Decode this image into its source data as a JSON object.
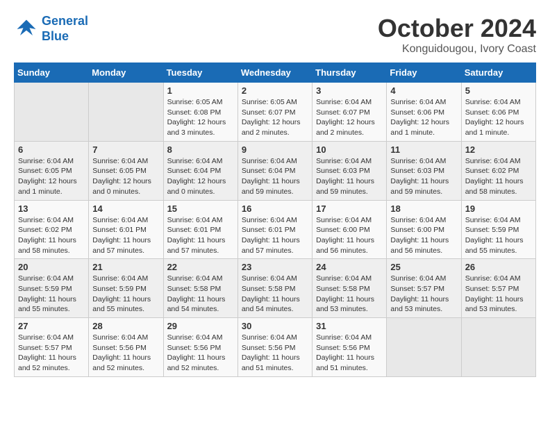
{
  "logo": {
    "line1": "General",
    "line2": "Blue"
  },
  "title": "October 2024",
  "location": "Konguidougou, Ivory Coast",
  "weekdays": [
    "Sunday",
    "Monday",
    "Tuesday",
    "Wednesday",
    "Thursday",
    "Friday",
    "Saturday"
  ],
  "weeks": [
    [
      {
        "day": "",
        "info": ""
      },
      {
        "day": "",
        "info": ""
      },
      {
        "day": "1",
        "info": "Sunrise: 6:05 AM\nSunset: 6:08 PM\nDaylight: 12 hours\nand 3 minutes."
      },
      {
        "day": "2",
        "info": "Sunrise: 6:05 AM\nSunset: 6:07 PM\nDaylight: 12 hours\nand 2 minutes."
      },
      {
        "day": "3",
        "info": "Sunrise: 6:04 AM\nSunset: 6:07 PM\nDaylight: 12 hours\nand 2 minutes."
      },
      {
        "day": "4",
        "info": "Sunrise: 6:04 AM\nSunset: 6:06 PM\nDaylight: 12 hours\nand 1 minute."
      },
      {
        "day": "5",
        "info": "Sunrise: 6:04 AM\nSunset: 6:06 PM\nDaylight: 12 hours\nand 1 minute."
      }
    ],
    [
      {
        "day": "6",
        "info": "Sunrise: 6:04 AM\nSunset: 6:05 PM\nDaylight: 12 hours\nand 1 minute."
      },
      {
        "day": "7",
        "info": "Sunrise: 6:04 AM\nSunset: 6:05 PM\nDaylight: 12 hours\nand 0 minutes."
      },
      {
        "day": "8",
        "info": "Sunrise: 6:04 AM\nSunset: 6:04 PM\nDaylight: 12 hours\nand 0 minutes."
      },
      {
        "day": "9",
        "info": "Sunrise: 6:04 AM\nSunset: 6:04 PM\nDaylight: 11 hours\nand 59 minutes."
      },
      {
        "day": "10",
        "info": "Sunrise: 6:04 AM\nSunset: 6:03 PM\nDaylight: 11 hours\nand 59 minutes."
      },
      {
        "day": "11",
        "info": "Sunrise: 6:04 AM\nSunset: 6:03 PM\nDaylight: 11 hours\nand 59 minutes."
      },
      {
        "day": "12",
        "info": "Sunrise: 6:04 AM\nSunset: 6:02 PM\nDaylight: 11 hours\nand 58 minutes."
      }
    ],
    [
      {
        "day": "13",
        "info": "Sunrise: 6:04 AM\nSunset: 6:02 PM\nDaylight: 11 hours\nand 58 minutes."
      },
      {
        "day": "14",
        "info": "Sunrise: 6:04 AM\nSunset: 6:01 PM\nDaylight: 11 hours\nand 57 minutes."
      },
      {
        "day": "15",
        "info": "Sunrise: 6:04 AM\nSunset: 6:01 PM\nDaylight: 11 hours\nand 57 minutes."
      },
      {
        "day": "16",
        "info": "Sunrise: 6:04 AM\nSunset: 6:01 PM\nDaylight: 11 hours\nand 57 minutes."
      },
      {
        "day": "17",
        "info": "Sunrise: 6:04 AM\nSunset: 6:00 PM\nDaylight: 11 hours\nand 56 minutes."
      },
      {
        "day": "18",
        "info": "Sunrise: 6:04 AM\nSunset: 6:00 PM\nDaylight: 11 hours\nand 56 minutes."
      },
      {
        "day": "19",
        "info": "Sunrise: 6:04 AM\nSunset: 5:59 PM\nDaylight: 11 hours\nand 55 minutes."
      }
    ],
    [
      {
        "day": "20",
        "info": "Sunrise: 6:04 AM\nSunset: 5:59 PM\nDaylight: 11 hours\nand 55 minutes."
      },
      {
        "day": "21",
        "info": "Sunrise: 6:04 AM\nSunset: 5:59 PM\nDaylight: 11 hours\nand 55 minutes."
      },
      {
        "day": "22",
        "info": "Sunrise: 6:04 AM\nSunset: 5:58 PM\nDaylight: 11 hours\nand 54 minutes."
      },
      {
        "day": "23",
        "info": "Sunrise: 6:04 AM\nSunset: 5:58 PM\nDaylight: 11 hours\nand 54 minutes."
      },
      {
        "day": "24",
        "info": "Sunrise: 6:04 AM\nSunset: 5:58 PM\nDaylight: 11 hours\nand 53 minutes."
      },
      {
        "day": "25",
        "info": "Sunrise: 6:04 AM\nSunset: 5:57 PM\nDaylight: 11 hours\nand 53 minutes."
      },
      {
        "day": "26",
        "info": "Sunrise: 6:04 AM\nSunset: 5:57 PM\nDaylight: 11 hours\nand 53 minutes."
      }
    ],
    [
      {
        "day": "27",
        "info": "Sunrise: 6:04 AM\nSunset: 5:57 PM\nDaylight: 11 hours\nand 52 minutes."
      },
      {
        "day": "28",
        "info": "Sunrise: 6:04 AM\nSunset: 5:56 PM\nDaylight: 11 hours\nand 52 minutes."
      },
      {
        "day": "29",
        "info": "Sunrise: 6:04 AM\nSunset: 5:56 PM\nDaylight: 11 hours\nand 52 minutes."
      },
      {
        "day": "30",
        "info": "Sunrise: 6:04 AM\nSunset: 5:56 PM\nDaylight: 11 hours\nand 51 minutes."
      },
      {
        "day": "31",
        "info": "Sunrise: 6:04 AM\nSunset: 5:56 PM\nDaylight: 11 hours\nand 51 minutes."
      },
      {
        "day": "",
        "info": ""
      },
      {
        "day": "",
        "info": ""
      }
    ]
  ]
}
